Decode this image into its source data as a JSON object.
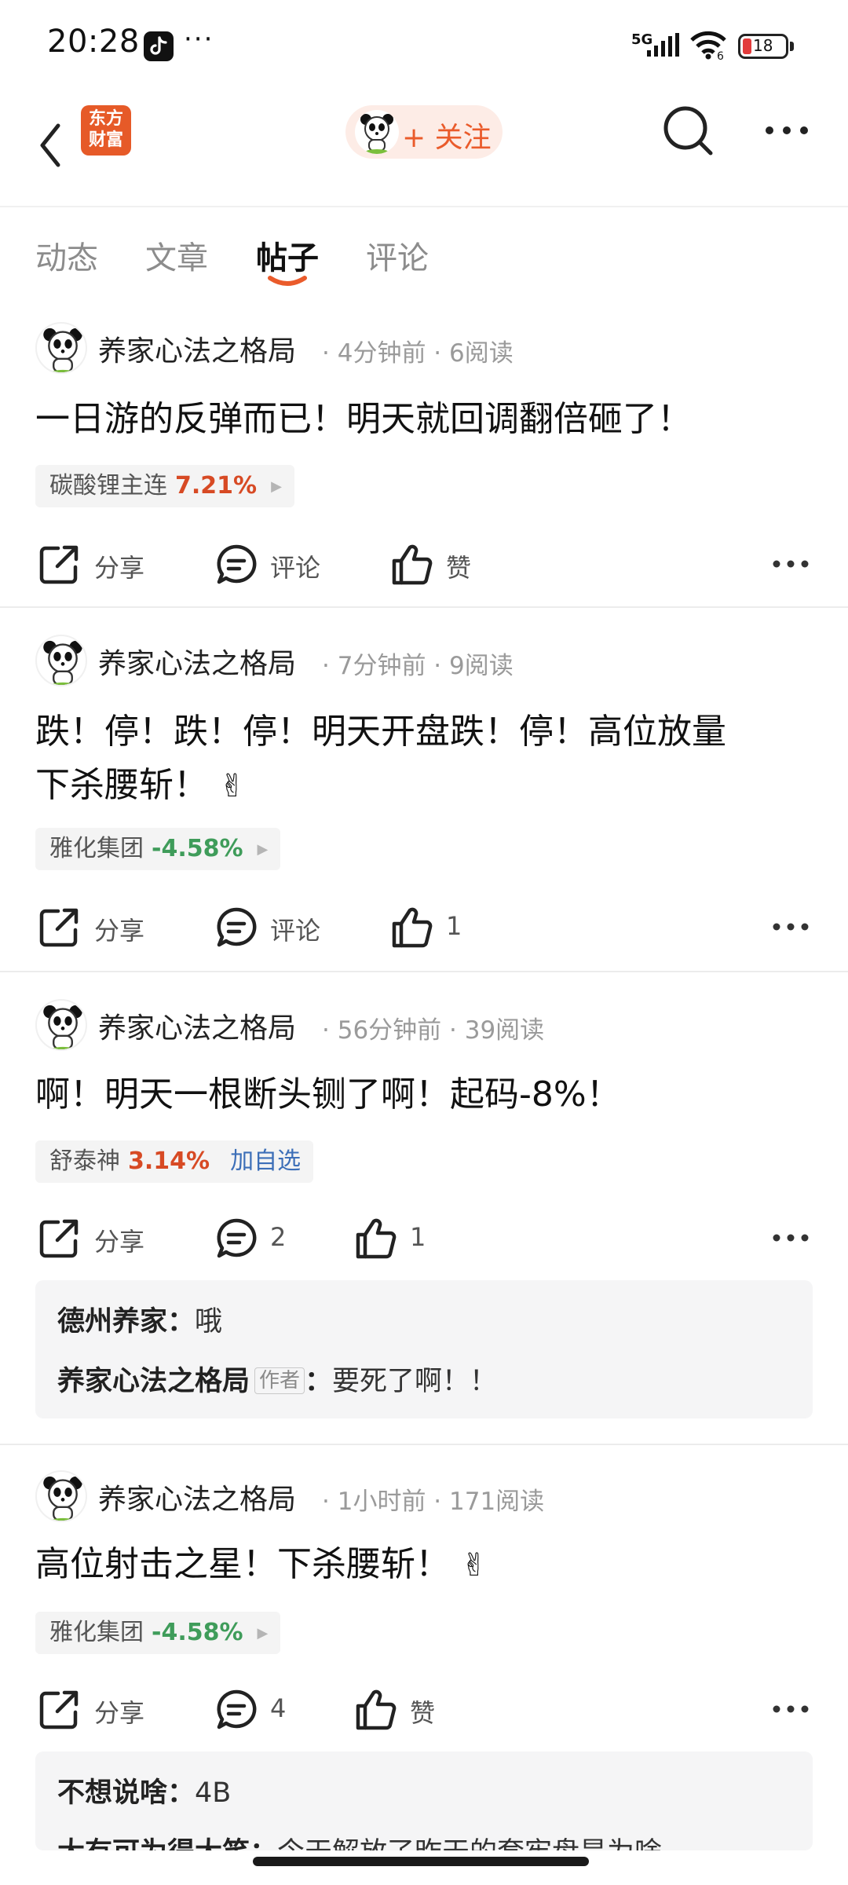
{
  "status_bar": {
    "time": "20:28",
    "dots": "···",
    "network": "5G",
    "wifi_sub": "6",
    "battery": "18",
    "apps": [
      "tiktok-icon"
    ]
  },
  "header": {
    "brand_line1": "东方",
    "brand_line2": "财富",
    "follow_label": "+ 关注",
    "icons": [
      "back-arrow-icon",
      "search-icon",
      "more-icon"
    ]
  },
  "tabs": [
    {
      "label": "动态",
      "active": false
    },
    {
      "label": "文章",
      "active": false
    },
    {
      "label": "帖子",
      "active": true
    },
    {
      "label": "评论",
      "active": false
    }
  ],
  "colors": {
    "brand": "#e65a28",
    "follow_text": "#ea5b2b",
    "stock_up": "#d74a24",
    "stock_down": "#3f9c5a",
    "link_blue": "#3d6fb8"
  },
  "posts": [
    {
      "author": "养家心法之格局",
      "time": "4分钟前",
      "reads": "6阅读",
      "content": "一日游的反弹而已！明天就回调翻倍砸了！",
      "stock_name": "碳酸锂主连",
      "stock_pct": "7.21%",
      "share": "分享",
      "comment": "评论",
      "like": "赞"
    },
    {
      "author": "养家心法之格局",
      "time": "7分钟前",
      "reads": "9阅读",
      "content_line1": "跌！停！跌！停！明天开盘跌！停！高位放量",
      "content_line2": "下杀腰斩！",
      "emoji": "✌",
      "stock_name": "雅化集团",
      "stock_pct": "-4.58%",
      "share": "分享",
      "comment": "评论",
      "like": "1"
    },
    {
      "author": "养家心法之格局",
      "time": "56分钟前",
      "reads": "39阅读",
      "content": "啊！明天一根断头铡了啊！起码-8%！",
      "stock_name": "舒泰神",
      "stock_pct": "3.14%",
      "stock_add": "加自选",
      "share": "分享",
      "comment": "2",
      "like": "1",
      "comments": [
        {
          "user": "德州养家：",
          "text": "哦"
        },
        {
          "user": "养家心法之格局",
          "badge": "作者",
          "sep": "：",
          "text": "要死了啊！！"
        }
      ]
    },
    {
      "author": "养家心法之格局",
      "time": "1小时前",
      "reads": "171阅读",
      "content": "高位射击之星！下杀腰斩！",
      "emoji": "✌",
      "stock_name": "雅化集团",
      "stock_pct": "-4.58%",
      "share": "分享",
      "comment": "4",
      "like": "赞",
      "comments": [
        {
          "user": "不想说啥：",
          "text": "4B"
        },
        {
          "user": "大有可为得大笑：",
          "text": "今天解放了昨天的套牢盘是为啥"
        }
      ]
    }
  ]
}
